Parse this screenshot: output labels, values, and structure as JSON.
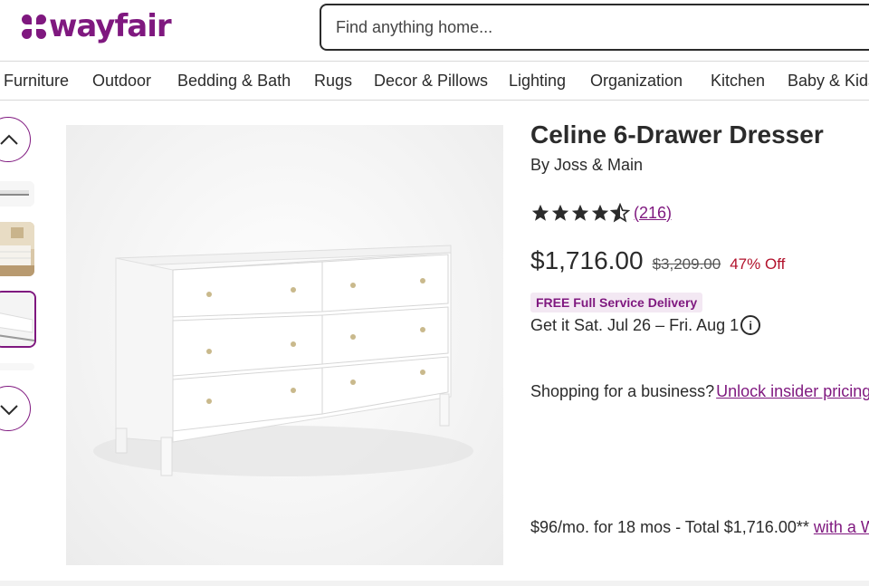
{
  "header": {
    "logo_text": "wayfair",
    "search_placeholder": "Find anything home..."
  },
  "nav": {
    "items": [
      "Furniture",
      "Outdoor",
      "Bedding & Bath",
      "Rugs",
      "Decor & Pillows",
      "Lighting",
      "Organization",
      "Kitchen",
      "Baby & Kids"
    ]
  },
  "gallery": {
    "up_icon": "chevron-up-icon",
    "down_icon": "chevron-down-icon",
    "selected_thumbnail": 3
  },
  "product": {
    "title": "Celine 6-Drawer Dresser",
    "brand": "By Joss & Main",
    "rating": 4.5,
    "rating_max": 5,
    "review_count": "(216)",
    "price": "$1,716.00",
    "old_price": "$3,209.00",
    "discount": "47% Off",
    "delivery_badge": "FREE Full Service Delivery",
    "delivery_date": "Get it Sat. Jul 26 – Fri. Aug 1",
    "info_icon": "info-icon",
    "business_text": "Shopping for a business?",
    "business_link": "Unlock insider pricing",
    "financing_text": "$96/mo. for 18 mos - Total $1,716.00**",
    "financing_link": "with a W"
  },
  "colors": {
    "brand": "#7f187f",
    "discount": "#b2112b",
    "text": "#2b2b2b"
  }
}
